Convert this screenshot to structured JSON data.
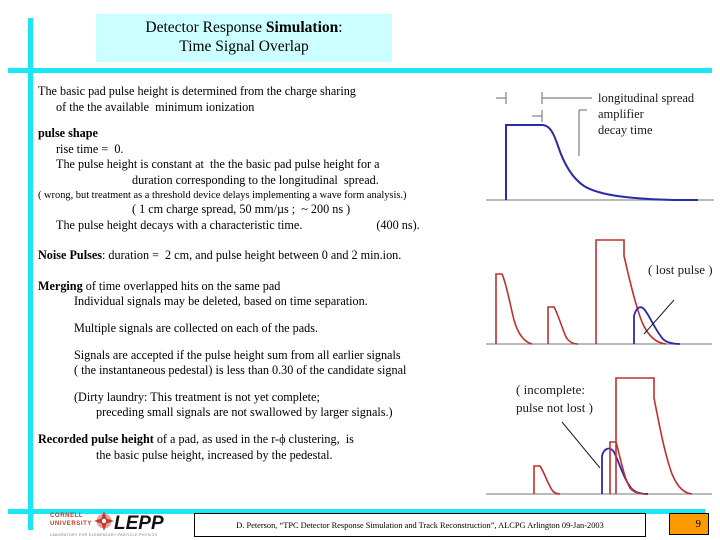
{
  "slide": {
    "title_line1_plain": "Detector Response ",
    "title_line1_bold": "Simulation",
    "title_line1_tail": ":",
    "title_line2": "Time Signal Overlap",
    "accent_cyan": "#19E7F5",
    "title_box_bg": "#CCFFFF",
    "page_badge_bg": "#FF9900"
  },
  "body": {
    "intro_l1": "The basic pad pulse height is determined from the charge sharing",
    "intro_l2": "of the the available  minimum ionization",
    "pulse_shape_heading": "pulse shape",
    "rise_time": "rise time =  0.",
    "const_l1": "The pulse height is constant at  the the basic pad pulse height for a",
    "const_l2": "duration corresponding to the longitudinal  spread.",
    "wrong_note": "( wrong, but treatment as a threshold device delays implementing a wave form analysis.)",
    "spread_note": "( 1 cm charge spread, 50 mm/µs ;  ~ 200 ns )",
    "decay_l1": "The pulse height decays with a characteristic time.",
    "decay_value": "(400 ns).",
    "noise_heading": "Noise Pulses",
    "noise_rest": ": duration =  2 cm, and pulse height between 0 and 2 min.ion.",
    "merging_heading": "Merging",
    "merging_rest": " of time overlapped hits on the same pad",
    "merging_l2": "Individual signals may be deleted, based on time separation.",
    "multiple_signals": "Multiple signals are collected on each of the pads.",
    "accepted_l1": "Signals are accepted if the pulse height sum from all earlier signals",
    "accepted_l2": "( the instantaneous pedestal) is less than 0.30 of the candidate signal",
    "laundry_l1": "(Dirty laundry: This treatment is not yet complete;",
    "laundry_l2": "preceding small signals are not swallowed by larger signals.)",
    "recorded_heading": "Recorded pulse height",
    "recorded_rest": " of a pad, as used in the r-ϕ clustering,  is",
    "recorded_l2": "the basic pulse height, increased by the pedestal."
  },
  "figures": {
    "top": {
      "name": "single-pulse-shape-diagram",
      "label_longitudinal": "longitudinal spread",
      "label_amplifier_l1": "amplifier",
      "label_amplifier_l2": "decay time",
      "pulse_color": "#2B2BA8",
      "axis_color": "#808080"
    },
    "middle": {
      "name": "merged-pulses-lost-pulse-diagram",
      "annotation": "( lost pulse )",
      "pulse_color": "#C03030",
      "overlap_color": "#2B2BA8",
      "axis_color": "#808080"
    },
    "bottom": {
      "name": "merged-pulses-incomplete-diagram",
      "annotation_l1": "( incomplete:",
      "annotation_l2": "pulse not lost )",
      "pulse_color": "#C03030",
      "overlap_color": "#2B2BA8",
      "axis_color": "#808080"
    }
  },
  "footer": {
    "logo_top": "CORNELL",
    "logo_mid": "UNIVERSITY",
    "logo_name": "LEPP",
    "logo_sub": "LABORATORY FOR ELEMENTARY-PARTICLE PHYSICS",
    "citation": "D. Peterson, “TPC Detector Response  Simulation and Track Reconstruction”, ALCPG Arlington 09-Jan-2003",
    "page_number": "9"
  }
}
